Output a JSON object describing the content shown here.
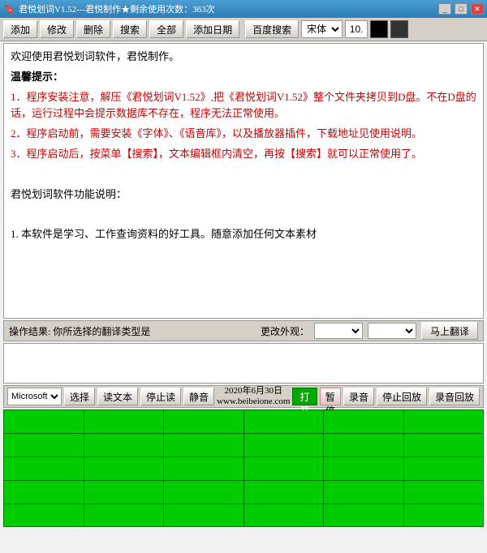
{
  "titleBar": {
    "title": "君悦划词V1.52---君悦制作★剩余使用次数：363次",
    "minimizeLabel": "_",
    "maximizeLabel": "□",
    "closeLabel": "✕"
  },
  "toolbar": {
    "addLabel": "添加",
    "editLabel": "修改",
    "deleteLabel": "删除",
    "searchLabel": "搜索",
    "allLabel": "全部",
    "addDateLabel": "添加日期",
    "baiduLabel": "百度搜索",
    "fontName": "宋体",
    "fontSize": "10.",
    "blackColor": "#000000",
    "darkColor": "#333333"
  },
  "mainContent": {
    "line1": "欢迎使用君悦划词软件，君悦制作。",
    "line2": "温馨提示：",
    "item1": "1．程序安装注意，解压《君悦划词V1.52》,把《君悦划词V1.52》整个文件夹拷贝到D盘。不在D盘的话，运行过程中会提示数据库不存在，程序无法正常使用。",
    "item2": "2．程序启动前，需要安装《字体》、《语音库》，以及播放器插件，下载地址见使用说明。",
    "item3": "3．程序启动后，按菜单【搜索】，文本编辑框内清空，再按【搜索】就可以正常使用了。",
    "line3": "君悦划词软件功能说明：",
    "item4": "1. 本软件是学习、工作查询资料的好工具。随意添加任何文本素材"
  },
  "statusBar": {
    "operationText": "操作结果: 你所选择的翻译类型是",
    "changeStyleLabel": "更改外观：",
    "translateLabel": "马上翻译"
  },
  "bottomToolbar": {
    "msOption": "Microsoft",
    "selectLabel": "选择",
    "readLabel": "读文本",
    "stopReadLabel": "停止读",
    "muteLabel": "静音",
    "date1": "2020年6月30日",
    "date2": "www.beibeione.com",
    "openLabel": "打开",
    "pauseLabel": "暂停",
    "recordLabel": "录音",
    "stopPlaybackLabel": "停止回放",
    "playbackLabel": "录音回放"
  },
  "grid": {
    "rows": 5,
    "cols": 6
  }
}
